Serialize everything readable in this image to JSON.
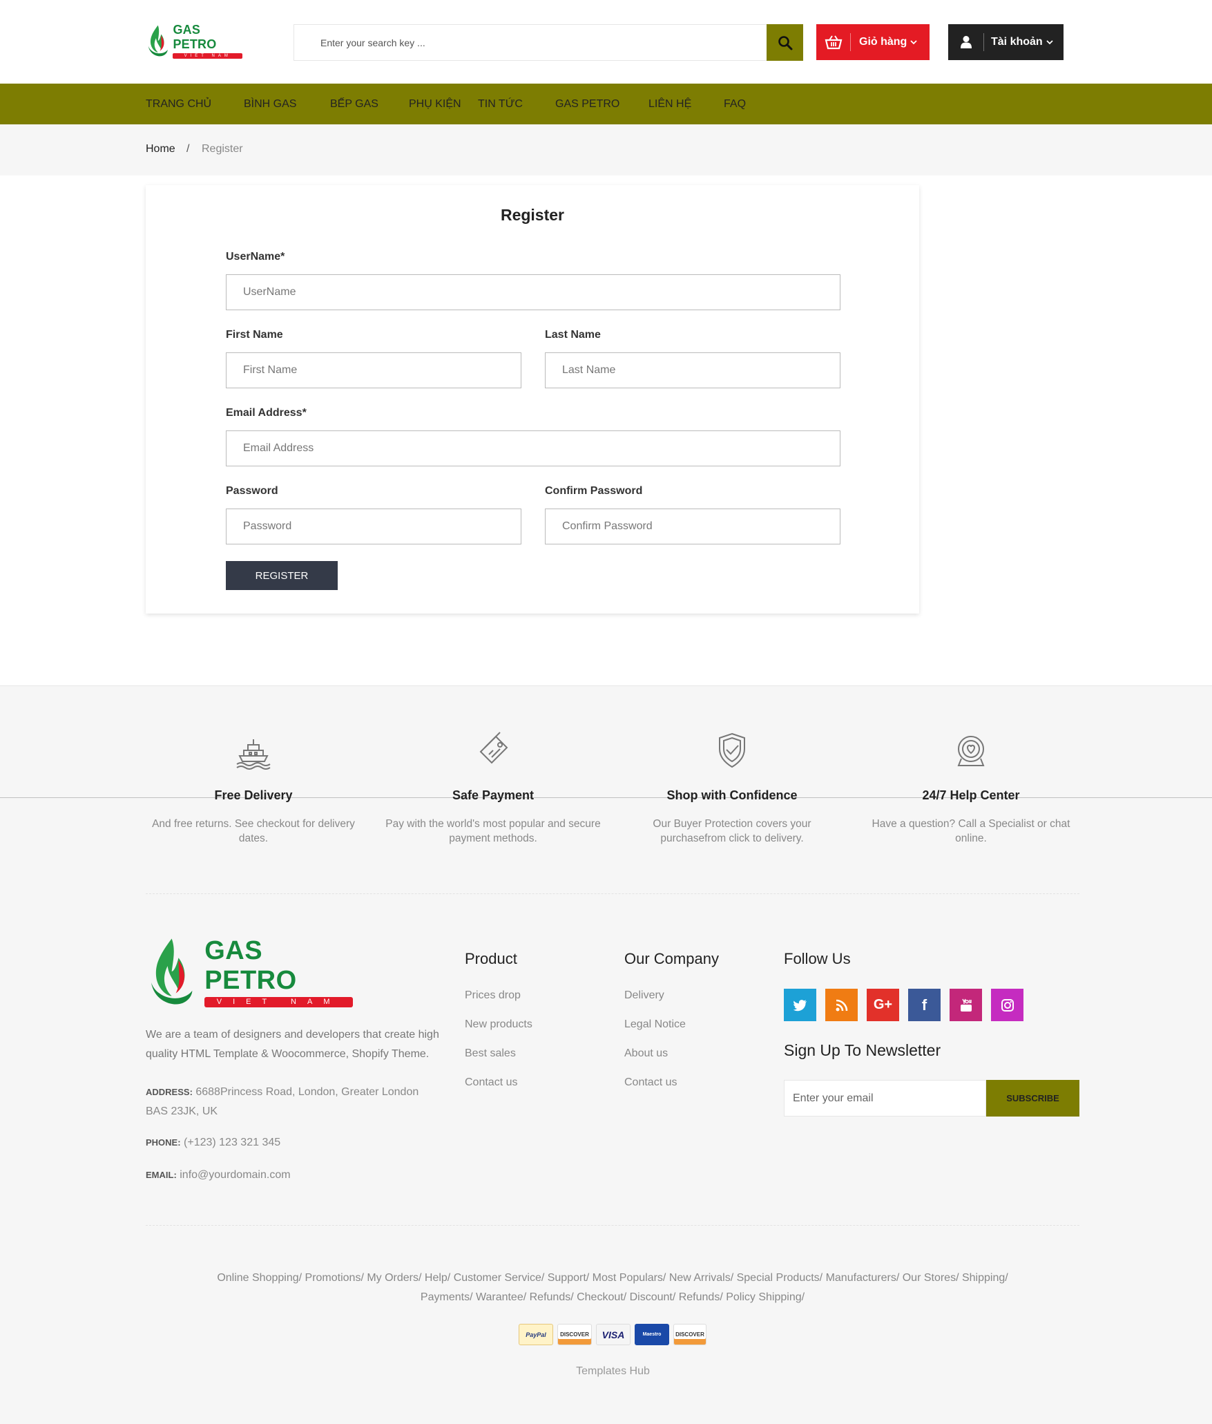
{
  "header": {
    "logo_brand": "GAS PETRO",
    "logo_sub": "VIET NAM",
    "search_placeholder": "Enter your search key ...",
    "cart_label": "Giỏ hàng",
    "account_label": "Tài khoản"
  },
  "nav": {
    "items": [
      "TRANG CHỦ",
      "BÌNH GAS",
      "BẾP GAS",
      "PHỤ KIỆN",
      "TIN TỨC",
      "GAS PETRO",
      "LIÊN HỆ",
      "FAQ"
    ]
  },
  "breadcrumb": {
    "home": "Home",
    "separator": "/",
    "current": "Register"
  },
  "form": {
    "title": "Register",
    "username_label": "UserName*",
    "username_placeholder": "UserName",
    "first_label": "First Name",
    "first_placeholder": "First Name",
    "last_label": "Last Name",
    "last_placeholder": "Last Name",
    "email_label": "Email Address*",
    "email_placeholder": "Email Address",
    "password_label": "Password",
    "password_placeholder": "Password",
    "confirm_label": "Confirm Password",
    "confirm_placeholder": "Confirm Password",
    "submit_label": "REGISTER"
  },
  "features": [
    {
      "title": "Free Delivery",
      "text": "And free returns. See checkout for delivery dates.",
      "icon": "ship-icon"
    },
    {
      "title": "Safe Payment",
      "text": "Pay with the world's most popular and secure payment methods.",
      "icon": "card-icon"
    },
    {
      "title": "Shop with Confidence",
      "text": "Our Buyer Protection covers your purchasefrom click to delivery.",
      "icon": "shield-check-icon"
    },
    {
      "title": "24/7 Help Center",
      "text": "Have a question? Call a Specialist or chat online.",
      "icon": "support-icon"
    }
  ],
  "footer": {
    "logo_brand": "GAS PETRO",
    "logo_sub": "VIET NAM",
    "description": "We are a team of designers and developers that create high quality HTML Template & Woocommerce, Shopify Theme.",
    "address_label": "ADDRESS:",
    "address": "6688Princess Road, London, Greater London BAS 23JK, UK",
    "phone_label": "PHONE:",
    "phone": "(+123) 123 321 345",
    "email_label": "EMAIL:",
    "email": "info@yourdomain.com",
    "product_title": "Product",
    "product_links": [
      "Prices drop",
      "New products",
      "Best sales",
      "Contact us"
    ],
    "company_title": "Our Company",
    "company_links": [
      "Delivery",
      "Legal Notice",
      "About us",
      "Contact us"
    ],
    "follow_title": "Follow Us",
    "social": [
      {
        "name": "twitter-icon",
        "color": "#1da1d6",
        "glyph": "t"
      },
      {
        "name": "rss-icon",
        "color": "#f07c13",
        "glyph": "rss"
      },
      {
        "name": "google-plus-icon",
        "color": "#e2312a",
        "glyph": "G+"
      },
      {
        "name": "facebook-icon",
        "color": "#3b5998",
        "glyph": "f"
      },
      {
        "name": "youtube-icon",
        "color": "#c3277a",
        "glyph": "yt"
      },
      {
        "name": "instagram-icon",
        "color": "#c52cc0",
        "glyph": "ig"
      }
    ],
    "newsletter_title": "Sign Up To Newsletter",
    "newsletter_placeholder": "Enter your email",
    "newsletter_button": "SUBSCRIBE",
    "bottom_links_line1": "Online Shopping/ Promotions/ My Orders/ Help/ Customer Service/ Support/ Most Populars/ New Arrivals/ Special Products/ Manufacturers/ Our Stores/ Shipping/",
    "bottom_links_line2": "Payments/ Warantee/ Refunds/ Checkout/ Discount/ Refunds/ Policy Shipping/",
    "payments": [
      "PayPal",
      "DISCOVER",
      "VISA",
      "Maestro",
      "DISCOVER"
    ],
    "credit": "Templates Hub"
  },
  "colors": {
    "olive": "#7d7d02",
    "cart_red": "#e41b24",
    "dark": "#222222",
    "button_dark": "#343a48"
  }
}
